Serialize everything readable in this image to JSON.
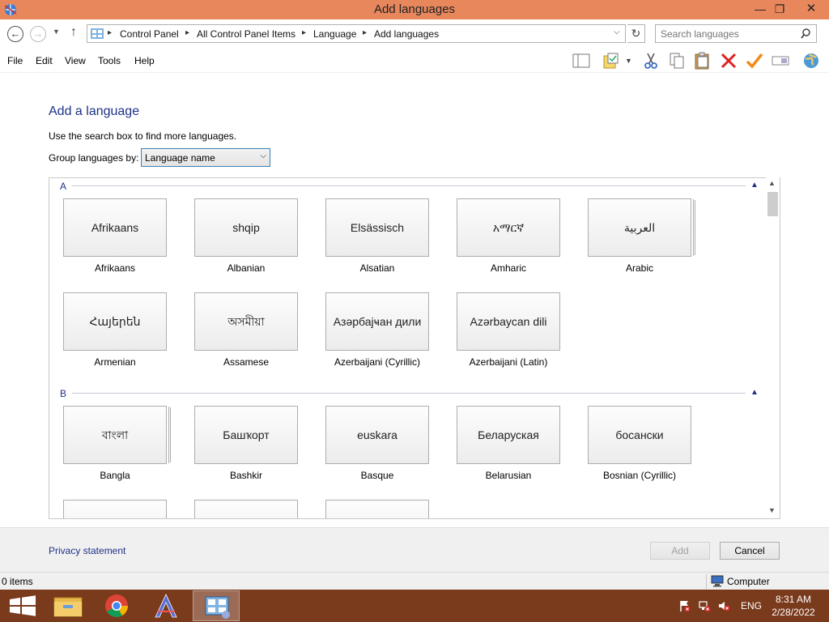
{
  "window": {
    "title": "Add languages"
  },
  "address": {
    "crumbs": [
      "Control Panel",
      "All Control Panel Items",
      "Language",
      "Add languages"
    ],
    "search_placeholder": "Search languages"
  },
  "menu": [
    "File",
    "Edit",
    "View",
    "Tools",
    "Help"
  ],
  "toolbar_icons": [
    "layout-icon",
    "properties-icon",
    "cut-icon",
    "copy-icon",
    "paste-icon",
    "delete-icon",
    "check-icon",
    "rename-icon",
    "globe-icon"
  ],
  "page": {
    "title": "Add a language",
    "hint": "Use the search box to find more languages.",
    "group_by_label": "Group languages by:",
    "group_by_value": "Language name"
  },
  "groups": [
    {
      "letter": "A",
      "languages": [
        {
          "native": "Afrikaans",
          "name": "Afrikaans"
        },
        {
          "native": "shqip",
          "name": "Albanian"
        },
        {
          "native": "Elsässisch",
          "name": "Alsatian"
        },
        {
          "native": "አማርኛ",
          "name": "Amharic"
        },
        {
          "native": "العربية",
          "name": "Arabic"
        },
        {
          "native": "Հայերեն",
          "name": "Armenian"
        },
        {
          "native": "অসমীয়া",
          "name": "Assamese"
        },
        {
          "native": "Азәрбајҹан дили",
          "name": "Azerbaijani (Cyrillic)"
        },
        {
          "native": "Azərbaycan dili",
          "name": "Azerbaijani (Latin)"
        }
      ]
    },
    {
      "letter": "B",
      "languages": [
        {
          "native": "বাংলা",
          "name": "Bangla"
        },
        {
          "native": "Башҡорт",
          "name": "Bashkir"
        },
        {
          "native": "euskara",
          "name": "Basque"
        },
        {
          "native": "Беларуская",
          "name": "Belarusian"
        },
        {
          "native": "босански",
          "name": "Bosnian (Cyrillic)"
        }
      ]
    }
  ],
  "footer": {
    "privacy": "Privacy statement",
    "add": "Add",
    "cancel": "Cancel"
  },
  "status": {
    "items": "0 items",
    "location": "Computer"
  },
  "taskbar": {
    "apps": [
      "start-button",
      "file-explorer",
      "chrome",
      "app-launcher",
      "control-panel"
    ],
    "lang": "ENG",
    "time": "8:31 AM",
    "date": "2/28/2022"
  }
}
